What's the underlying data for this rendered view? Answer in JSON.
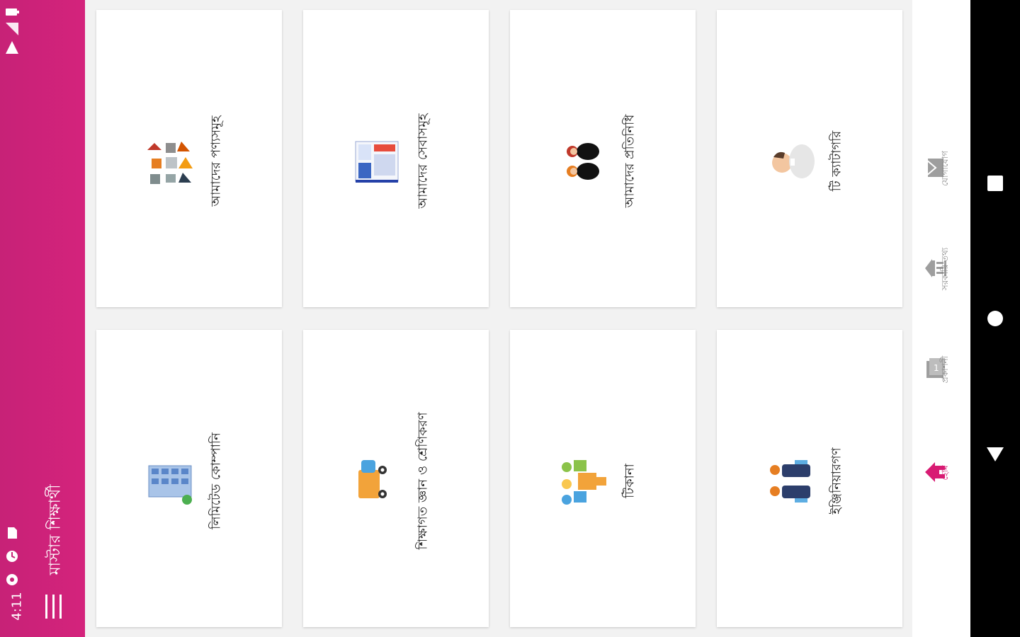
{
  "status_bar": {
    "time": "4:11"
  },
  "app_bar": {
    "title": "মাস্টার শিক্ষার্থী"
  },
  "cards": [
    {
      "label": "আমাদের পণ্যসমূহ",
      "icon": "products-icon"
    },
    {
      "label": "আমাদের সেবাসমূহ",
      "icon": "services-icon"
    },
    {
      "label": "আমাদের প্রতিনিধি",
      "icon": "representatives-icon"
    },
    {
      "label": "টি ক্যাটাগরি",
      "icon": "person-icon"
    },
    {
      "label": "লিমিটেড কোম্পানি",
      "icon": "office-building-icon"
    },
    {
      "label": "শিক্ষাগত জ্ঞান ও শ্রেণিকরণ",
      "icon": "delivery-truck-icon"
    },
    {
      "label": "টিকানা",
      "icon": "puzzle-team-icon"
    },
    {
      "label": "ইঞ্জিনিয়ারগণ",
      "icon": "engineers-icon"
    }
  ],
  "bottom_nav": {
    "items": [
      {
        "label": "হোম",
        "icon": "home-icon",
        "active": true
      },
      {
        "label": "প্রকাশনী",
        "icon": "book-icon",
        "active": false
      },
      {
        "label": "সরকারি তথ্য",
        "icon": "government-building-icon",
        "active": false
      },
      {
        "label": "যোগাযোগ",
        "icon": "mail-icon",
        "active": false
      }
    ]
  },
  "colors": {
    "accent": "#d4237c",
    "nav_bg": "#000000",
    "card_bg": "#ffffff",
    "page_bg": "#f2f2f2"
  }
}
